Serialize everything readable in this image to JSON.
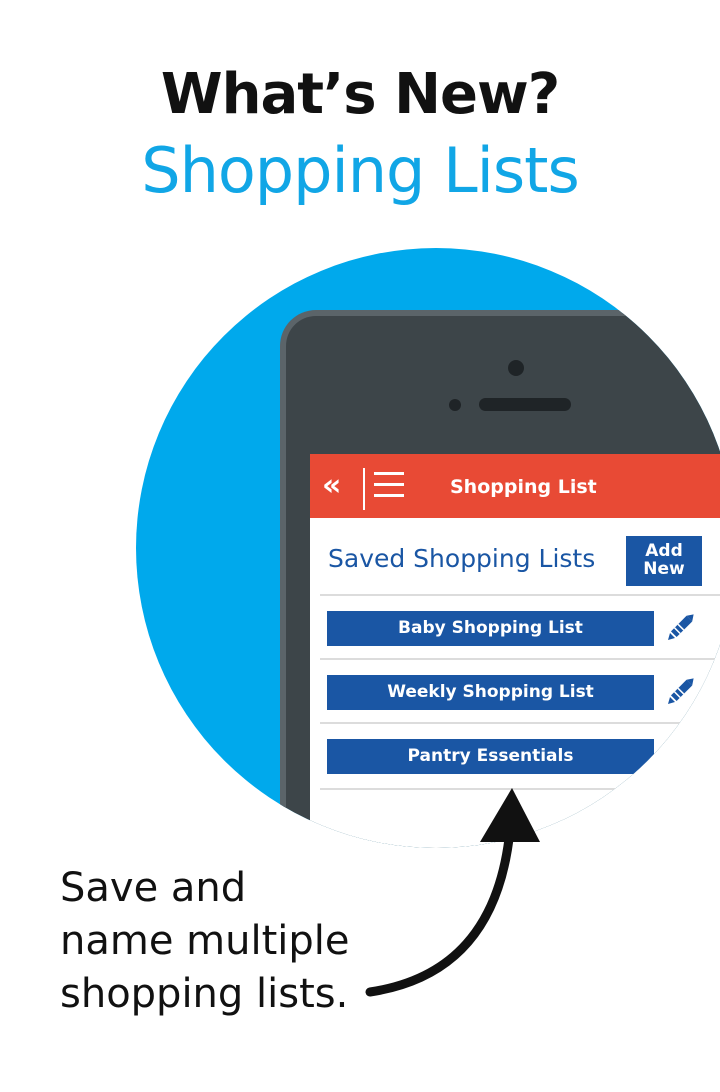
{
  "headline": {
    "line1": "What’s New?",
    "line2": "Shopping Lists"
  },
  "app": {
    "title": "Shopping List",
    "section_title": "Saved Shopping Lists",
    "add_new_label_line1": "Add",
    "add_new_label_line2": "New",
    "lists": [
      {
        "label": "Baby Shopping List",
        "editable": true
      },
      {
        "label": "Weekly Shopping List",
        "editable": true
      },
      {
        "label": "Pantry Essentials",
        "editable": false
      }
    ],
    "icons": {
      "back": "double-chevron-left-icon",
      "menu": "hamburger-menu-icon",
      "edit": "pencil-icon"
    },
    "back_glyph": "«"
  },
  "caption": {
    "line1": "Save and",
    "line2": "name multiple",
    "line3": "shopping lists."
  },
  "colors": {
    "accent_blue": "#11a6e6",
    "app_bar_red": "#e84a35",
    "button_blue": "#1a56a4"
  }
}
